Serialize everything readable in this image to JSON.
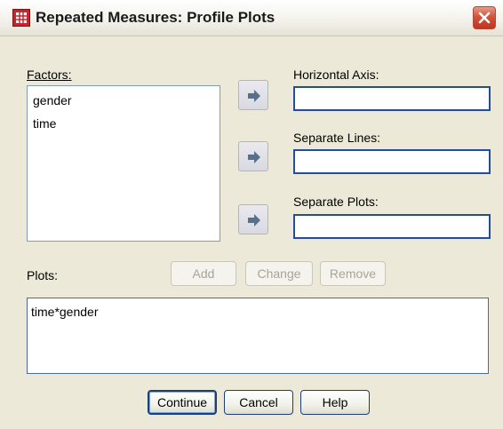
{
  "window": {
    "title": "Repeated Measures: Profile Plots",
    "icon": "spreadsheet-app-icon",
    "close_icon": "close-icon"
  },
  "factors": {
    "label": "Factors:",
    "items": [
      "gender",
      "time"
    ]
  },
  "targets": {
    "horizontal_axis": {
      "label": "Horizontal Axis:",
      "value": ""
    },
    "separate_lines": {
      "label": "Separate Lines:",
      "value": ""
    },
    "separate_plots": {
      "label": "Separate Plots:",
      "value": ""
    }
  },
  "move_button_icon": "arrow-right-icon",
  "plots": {
    "label": "Plots:",
    "items": [
      "time*gender"
    ]
  },
  "plot_buttons": {
    "add": "Add",
    "change": "Change",
    "remove": "Remove"
  },
  "footer": {
    "continue": "Continue",
    "cancel": "Cancel",
    "help": "Help"
  },
  "colors": {
    "dialog_bg": "#ece9d8",
    "field_border": "#224f9d",
    "close_red": "#c8432a"
  }
}
